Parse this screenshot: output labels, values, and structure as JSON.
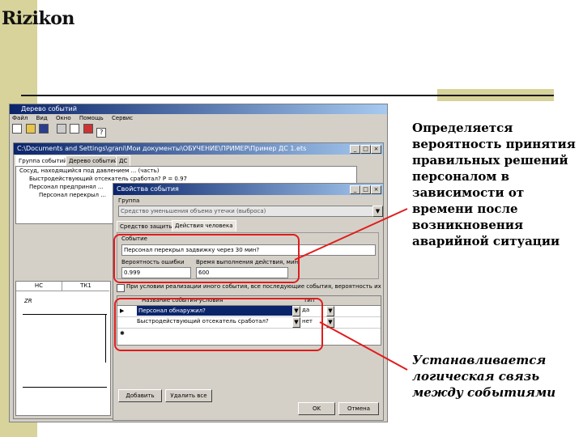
{
  "logo": {
    "text": "Rizikon"
  },
  "main_window": {
    "title": "Дерево событий",
    "menu": [
      "Файл",
      "Вид",
      "Окно",
      "Помощь",
      "Сервис"
    ],
    "doc_title": "C:\\Documents and Settings\\grani\\Мои документы\\ОБУЧЕНИЕ\\ПРИМЕР\\Пример ДС 1.ets",
    "tabs": [
      "Группа событий",
      "Дерево событий",
      "ДС"
    ],
    "tree": [
      "Сосуд, находящийся под давлением ... (часть)",
      "Быстродействующий отсекатель сработал? P = 0.97",
      "Персонал предпринял ...",
      "Персонал перекрыл ..."
    ],
    "labels": {
      "ns": "НС",
      "tk1": "ТК1",
      "zr": "ZR"
    }
  },
  "dialog": {
    "title": "Свойства события",
    "group_label": "Группа",
    "group_value": "Средство уменьшения объема утечки (выброса)",
    "tabs": [
      "Средство защиты",
      "Действия человека"
    ],
    "event_label": "Событие",
    "event_value": "Персонал перекрыл задвижку через 30 мин?",
    "error_prob_label": "Вероятность ошибки",
    "error_prob_value": "0.999",
    "time_label": "Время выполнения действия, мин",
    "time_value": "600",
    "checkbox_label": "При условии реализации иного события, все последующие события, вероятность их выполнения ...",
    "cols": [
      "Название события-условия",
      "Тип"
    ],
    "rows": [
      {
        "marker": "▶",
        "name": "Персонал обнаружил?",
        "type": "да"
      },
      {
        "marker": "",
        "name": "Быстродействующий отсекатель сработал?",
        "type": "нет"
      },
      {
        "marker": "✱",
        "name": "",
        "type": ""
      }
    ],
    "buttons": {
      "add": "Добавить",
      "delete_all": "Удалить все",
      "ok": "OK",
      "cancel": "Отмена"
    }
  },
  "annotations": {
    "a1": "Определяется вероятность принятия правильных решений персоналом в зависимости от времени после возникновения аварийной ситуации",
    "a2": "Устанавливается логическая связь между событиями"
  }
}
